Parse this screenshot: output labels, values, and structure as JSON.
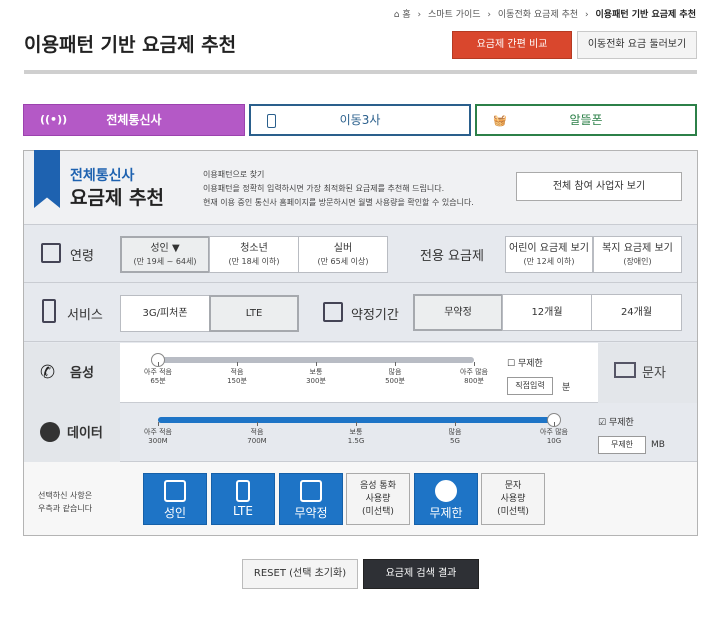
{
  "breadcrumb": {
    "home": "⌂ 홈",
    "items": [
      "스마트 가이드",
      "이동전화 요금제 추천"
    ],
    "current": "이용패턴 기반 요금제 추천"
  },
  "page": {
    "title": "이용패턴 기반 요금제 추천"
  },
  "header_buttons": {
    "compare": "요금제 간편 비교",
    "browse": "이동전화 요금 둘러보기"
  },
  "tabs": [
    {
      "label": "전체통신사"
    },
    {
      "label": "이동3사"
    },
    {
      "label": "알뜰폰"
    }
  ],
  "intro": {
    "subtitle": "전체통신사",
    "title": "요금제 추천",
    "line1": "이용패턴으로 찾기",
    "line2": "이용패턴을 정확히 입력하시면 가장 최적화된 요금제를 추천해 드립니다.",
    "line3": "현재 이용 중인 통신사 홈페이지를 방문하시면 월별 사용량을 확인할 수 있습니다.",
    "participants_button": "전체 참여 사업자 보기"
  },
  "age": {
    "label": "연령",
    "options": [
      {
        "name": "성인 ▼",
        "sub": "(만 19세 ~ 64세)"
      },
      {
        "name": "청소년",
        "sub": "(만 18세 이하)"
      },
      {
        "name": "실버",
        "sub": "(만 65세 이상)"
      }
    ]
  },
  "dedicated": {
    "label": "전용 요금제",
    "options": [
      {
        "name": "어린이 요금제 보기",
        "sub": "(만 12세 이하)"
      },
      {
        "name": "복지 요금제 보기",
        "sub": "(장애인)"
      }
    ]
  },
  "service": {
    "label": "서비스",
    "options": [
      "3G/피처폰",
      "LTE"
    ]
  },
  "contract": {
    "label": "약정기간",
    "options": [
      "무약정",
      "12개월",
      "24개월"
    ]
  },
  "voice": {
    "label": "음성",
    "ticks": [
      {
        "name": "아주 적음",
        "val": "65분"
      },
      {
        "name": "적음",
        "val": "150분"
      },
      {
        "name": "보통",
        "val": "300분"
      },
      {
        "name": "많음",
        "val": "500분"
      },
      {
        "name": "아주 많음",
        "val": "800분"
      }
    ],
    "level": 0.0,
    "unlimited_label": "무제한",
    "unlimited_checked": false,
    "direct_input": "직접입력",
    "unit": "분"
  },
  "sms": {
    "label": "문자"
  },
  "data": {
    "label": "데이터",
    "ticks": [
      {
        "name": "아주 적음",
        "val": "300M"
      },
      {
        "name": "적음",
        "val": "700M"
      },
      {
        "name": "보통",
        "val": "1.5G"
      },
      {
        "name": "많음",
        "val": "5G"
      },
      {
        "name": "아주 많음",
        "val": "10G"
      }
    ],
    "level": 1.0,
    "unlimited_label": "무제한",
    "unlimited_checked": true,
    "input_value": "무제한",
    "unit": "MB"
  },
  "summary": {
    "text1": "선택하신 사항은",
    "text2": "우측과 같습니다",
    "cards": [
      {
        "label": "성인",
        "type": "blue",
        "icon": "person-icon"
      },
      {
        "label": "LTE",
        "type": "blue",
        "icon": "phone-icon"
      },
      {
        "label": "무약정",
        "type": "blue",
        "icon": "calendar-icon"
      },
      {
        "label1": "음성 통화",
        "label2": "사용량",
        "label3": "(미선택)",
        "type": "gray"
      },
      {
        "label": "무제한",
        "type": "blue",
        "icon": "pie-icon"
      },
      {
        "label1": "문자",
        "label2": "사용량",
        "label3": "(미선택)",
        "type": "gray"
      }
    ]
  },
  "actions": {
    "reset": "RESET (선택 초기화)",
    "search": "요금제 검색 결과"
  },
  "colors": {
    "accent_red": "#d9472d",
    "tab_purple": "#b459c6",
    "blue": "#1e74c6",
    "dark": "#2e3035"
  }
}
